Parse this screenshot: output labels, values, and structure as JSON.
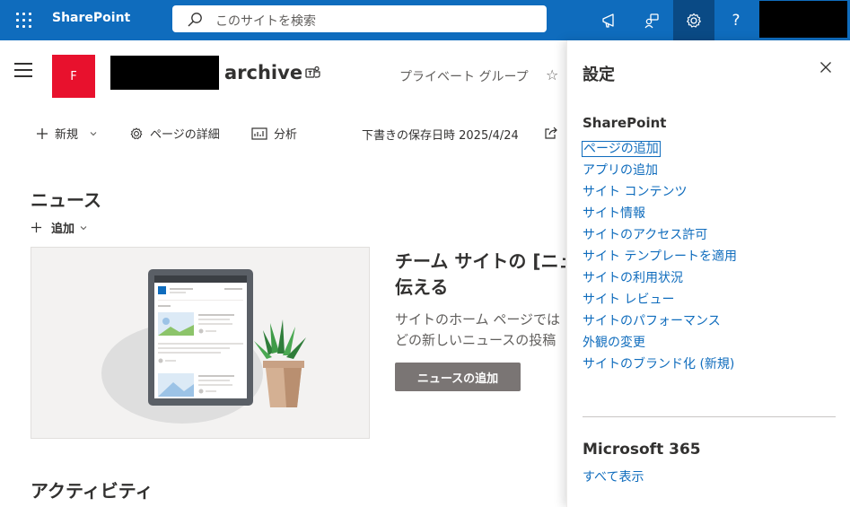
{
  "suitebar": {
    "app_name": "SharePoint",
    "search_placeholder": "このサイトを検索",
    "icons": [
      "waffle-icon",
      "megaphone-icon",
      "chat-feedback-icon",
      "gear-icon",
      "help-icon"
    ],
    "help_glyph": "?"
  },
  "site": {
    "logo_letter": "F",
    "title": "archive",
    "group_label": "プライベート グループ",
    "star_glyph": "☆"
  },
  "commands": {
    "new_label": "新規",
    "page_details_label": "ページの詳細",
    "analytics_label": "分析",
    "save_status": "下書きの保存日時 2025/4/24"
  },
  "news": {
    "heading": "ニュース",
    "add_label": "追加",
    "title_line1": "チーム サイトの [ニュ",
    "title_line2": "伝える",
    "desc_line1": "サイトのホーム ページでは",
    "desc_line2": "どの新しいニュースの投稿",
    "add_button": "ニュースの追加"
  },
  "activity": {
    "heading": "アクティビティ"
  },
  "settings_panel": {
    "title": "設定",
    "section_sharepoint": "SharePoint",
    "links": [
      "ページの追加",
      "アプリの追加",
      "サイト コンテンツ",
      "サイト情報",
      "サイトのアクセス許可",
      "サイト テンプレートを適用",
      "サイトの利用状況",
      "サイト レビュー",
      "サイトのパフォーマンス",
      "外観の変更",
      "サイトのブランド化 (新規)"
    ],
    "section_m365": "Microsoft 365",
    "show_all": "すべて表示"
  },
  "colors": {
    "suitebar": "#0f6cbd",
    "active_icon_bg": "#0a4a85",
    "site_logo": "#e8112d",
    "link": "#0f6cbd",
    "button_bg": "#7a7574"
  }
}
